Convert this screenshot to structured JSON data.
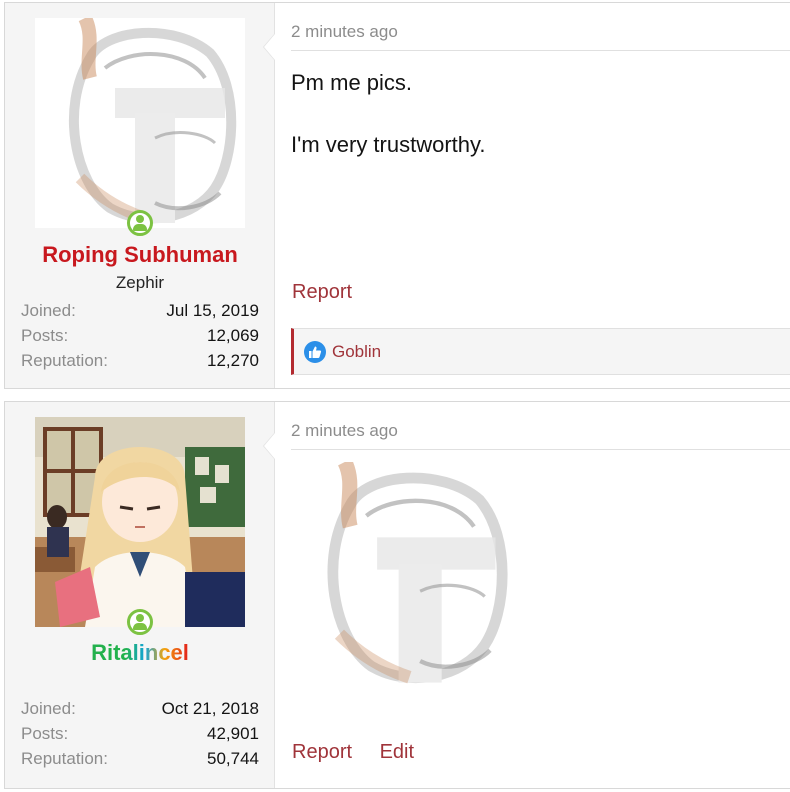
{
  "posts": [
    {
      "user": {
        "name": "Roping Subhuman",
        "title": "Zephir",
        "stats": [
          {
            "label": "Joined:",
            "value": "Jul 15, 2019"
          },
          {
            "label": "Posts:",
            "value": "12,069"
          },
          {
            "label": "Reputation:",
            "value": "12,270"
          }
        ]
      },
      "time": "2 minutes ago",
      "body": [
        "Pm me pics.",
        "I'm very trustworthy."
      ],
      "actions": [
        "Report"
      ],
      "reactions": {
        "icon": "like-icon",
        "users": "Goblin"
      }
    },
    {
      "user": {
        "name": "Ritalincel",
        "stats": [
          {
            "label": "Joined:",
            "value": "Oct 21, 2018"
          },
          {
            "label": "Posts:",
            "value": "42,901"
          },
          {
            "label": "Reputation:",
            "value": "50,744"
          }
        ]
      },
      "time": "2 minutes ago",
      "actions": [
        "Report",
        "Edit"
      ]
    }
  ],
  "colors": {
    "username_red": "#c8181e",
    "link": "#a0343a",
    "online": "#7cc242",
    "like": "#2b8fe8"
  }
}
